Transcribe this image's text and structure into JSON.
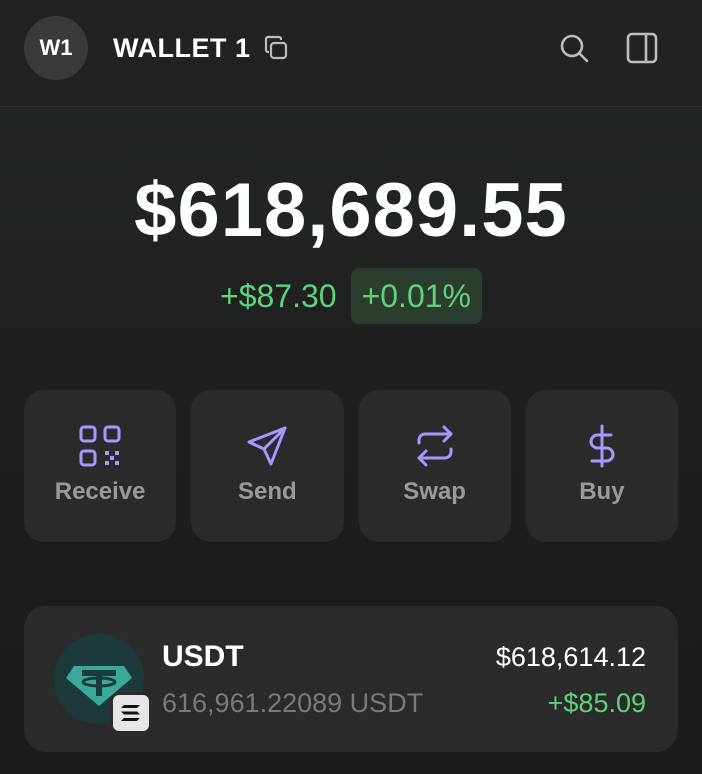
{
  "header": {
    "avatar_text": "W1",
    "wallet_name": "WALLET 1",
    "icons": [
      "copy-icon",
      "search-icon",
      "sidebar-icon"
    ]
  },
  "balance": {
    "total": "$618,689.55",
    "change_amount": "+$87.30",
    "change_percent": "+0.01%"
  },
  "actions": [
    {
      "label": "Receive",
      "icon": "qr-code-icon"
    },
    {
      "label": "Send",
      "icon": "send-icon"
    },
    {
      "label": "Swap",
      "icon": "swap-icon"
    },
    {
      "label": "Buy",
      "icon": "dollar-icon"
    }
  ],
  "tokens": [
    {
      "symbol": "USDT",
      "amount": "616,961.22089 USDT",
      "value": "$618,614.12",
      "change": "+$85.09",
      "icon": "tether-icon",
      "chain_icon": "solana-icon"
    }
  ],
  "colors": {
    "accent": "#a897ff",
    "positive": "#5fd27a",
    "positive_bg": "#2b3d2e",
    "card": "#2b2b2b",
    "background": "#222222"
  }
}
